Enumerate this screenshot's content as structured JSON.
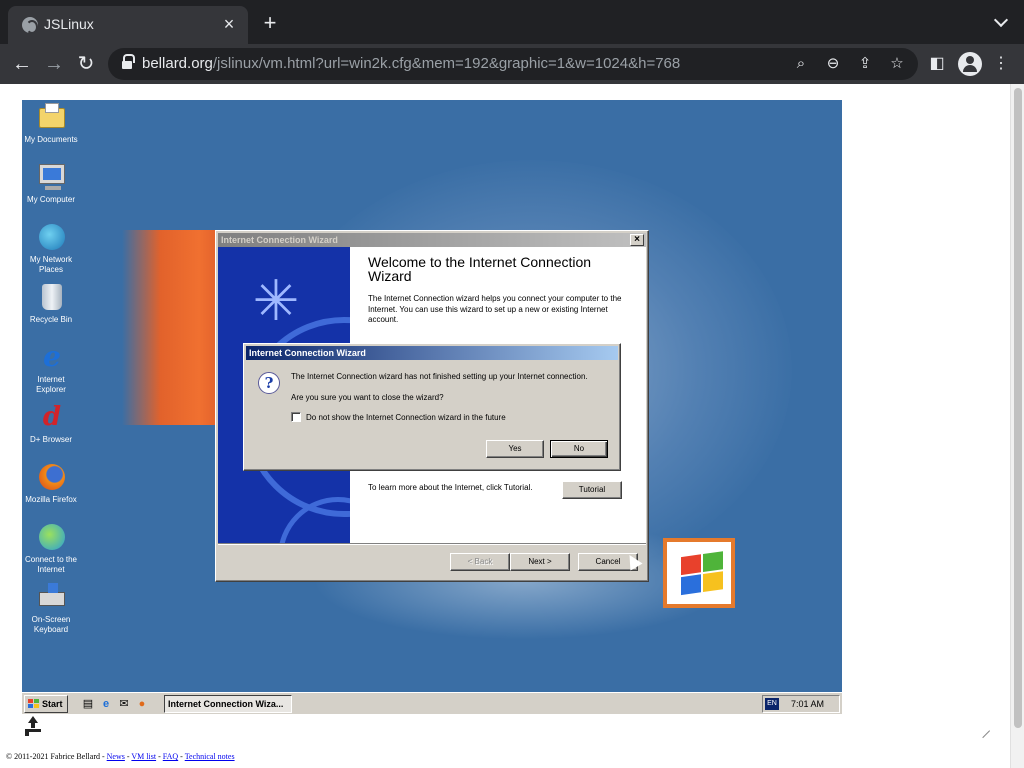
{
  "browser": {
    "tab_title": "JSLinux",
    "url_host": "bellard.org",
    "url_path": "/jslinux/vm.html?url=win2k.cfg&mem=192&graphic=1&w=1024&h=768"
  },
  "desktop": {
    "icons": [
      {
        "label": "My Documents",
        "icon": "folder-documents-icon"
      },
      {
        "label": "My Computer",
        "icon": "computer-icon"
      },
      {
        "label": "My Network Places",
        "icon": "network-places-icon"
      },
      {
        "label": "Recycle Bin",
        "icon": "recycle-bin-icon"
      },
      {
        "label": "Internet Explorer",
        "icon": "internet-explorer-icon"
      },
      {
        "label": "D+ Browser",
        "icon": "d-plus-browser-icon"
      },
      {
        "label": "Mozilla Firefox",
        "icon": "firefox-icon"
      },
      {
        "label": "Connect to the Internet",
        "icon": "connect-internet-icon"
      },
      {
        "label": "On-Screen Keyboard",
        "icon": "onscreen-keyboard-icon"
      }
    ]
  },
  "wizard": {
    "title": "Internet Connection Wizard",
    "heading": "Welcome to the Internet Connection Wizard",
    "intro": "The Internet Connection wizard helps you connect your computer to the Internet.  You can use this wizard to set up a new or existing Internet account.",
    "learn_more": "To learn more about the Internet, click Tutorial.",
    "tutorial_label": "Tutorial",
    "back_label": "< Back",
    "next_label": "Next >",
    "cancel_label": "Cancel"
  },
  "confirm": {
    "title": "Internet Connection Wizard",
    "message": "The Internet Connection wizard has not finished setting up your Internet connection.",
    "question": "Are you sure you want to close the wizard?",
    "checkbox_label": "Do not show the Internet Connection wizard in the future",
    "checkbox_checked": false,
    "yes_label": "Yes",
    "no_label": "No"
  },
  "taskbar": {
    "start_label": "Start",
    "task_label": "Internet Connection Wiza...",
    "language": "EN",
    "clock": "7:01 AM"
  },
  "footer": {
    "copyright": "© 2011-2021 Fabrice Bellard -",
    "links": [
      "News",
      "VM list",
      "FAQ",
      "Technical notes"
    ]
  }
}
